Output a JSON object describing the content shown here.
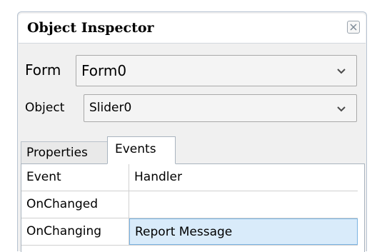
{
  "window": {
    "title": "Object Inspector",
    "close_icon": "close-icon"
  },
  "form_selector": {
    "label": "Form",
    "value": "Form0"
  },
  "object_selector": {
    "label": "Object",
    "value": "Slider0"
  },
  "tabs": [
    {
      "label": "Properties",
      "active": false
    },
    {
      "label": "Events",
      "active": true
    }
  ],
  "events_table": {
    "columns": [
      "Event",
      "Handler"
    ],
    "rows": [
      {
        "event": "OnChanged",
        "handler": ""
      },
      {
        "event": "OnChanging",
        "handler": "Report Message",
        "selected": true
      }
    ]
  },
  "colors": {
    "selection_fill": "#d9ebfa",
    "selection_border": "#7ab3e2",
    "panel_background": "#f0f0f0"
  }
}
